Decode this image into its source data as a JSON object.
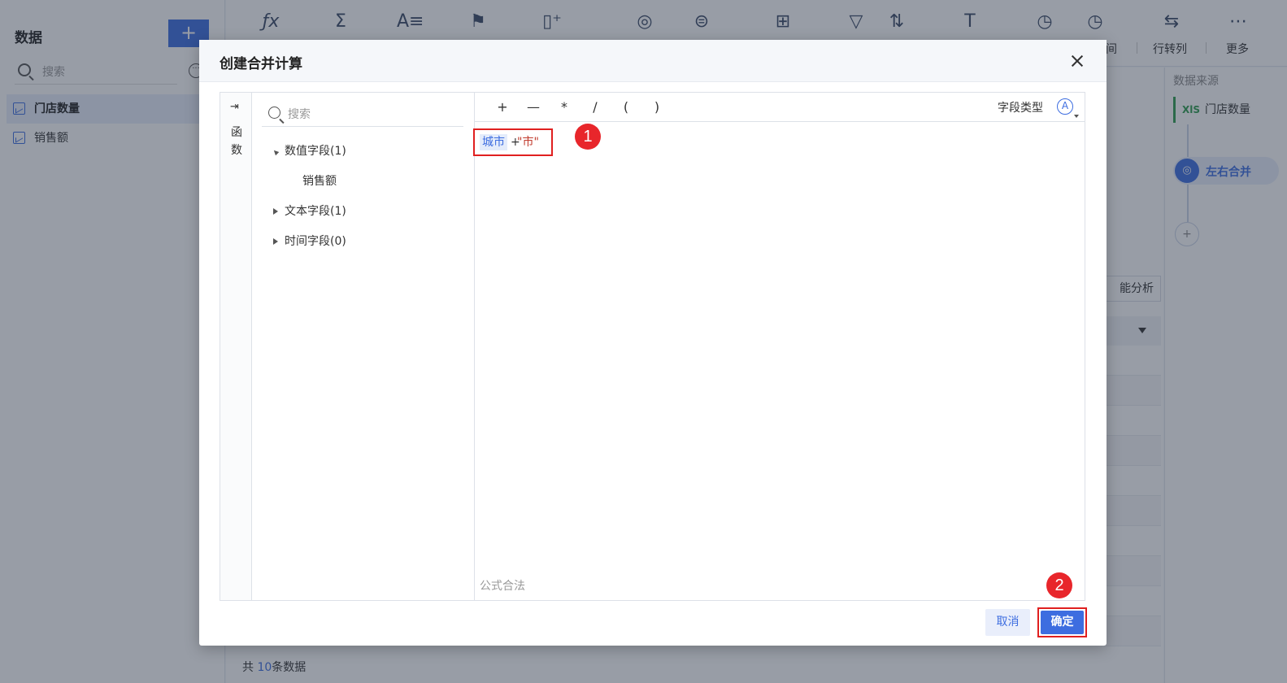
{
  "sidebar": {
    "title": "数据",
    "add_label": "+",
    "search_placeholder": "搜索",
    "items": [
      {
        "label": "门店数量"
      },
      {
        "label": "销售额"
      }
    ]
  },
  "toolbar": {
    "visible_labels": [
      "间",
      "行转列",
      "更多"
    ]
  },
  "right_panel": {
    "title": "数据来源",
    "source_badge": "XlS",
    "source_name": "门店数量",
    "merge_node": "左右合并",
    "add_node": "+"
  },
  "main": {
    "analysis_button": "能分析",
    "footer": {
      "prefix": "共",
      "count": "10",
      "suffix": "条数据"
    }
  },
  "dialog": {
    "title": "创建合并计算",
    "function_tab": {
      "label_line1": "函",
      "label_line2": "数"
    },
    "field_search_placeholder": "搜索",
    "tree": [
      {
        "label": "数值字段(1)",
        "expanded": true,
        "children": [
          "销售额"
        ]
      },
      {
        "label": "文本字段(1)",
        "expanded": false
      },
      {
        "label": "时间字段(0)",
        "expanded": false
      }
    ],
    "operators": [
      "+",
      "—",
      "*",
      "/",
      "(",
      ")"
    ],
    "field_type_label": "字段类型",
    "field_type_icon": "A",
    "formula": {
      "field_token": "城市",
      "operator": "+",
      "string_literal": "\"市\""
    },
    "validity_text": "公式合法",
    "annotations": [
      "1",
      "2"
    ],
    "buttons": {
      "cancel": "取消",
      "ok": "确定"
    }
  },
  "colors": {
    "accent": "#3d6de0",
    "highlight_red": "#e02020",
    "badge_red": "#e8262b"
  }
}
